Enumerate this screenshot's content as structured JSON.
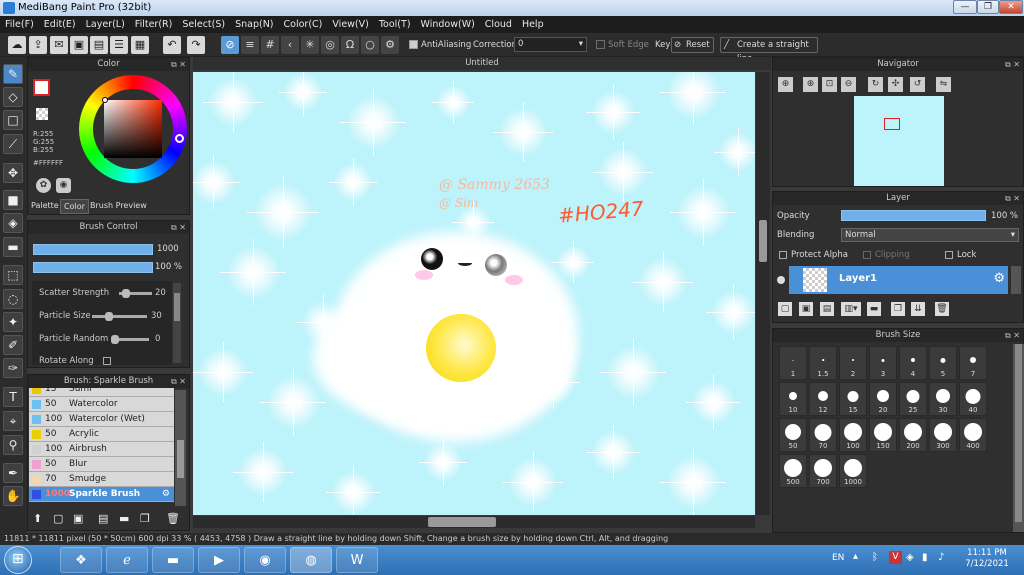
{
  "window": {
    "title": "MediBang Paint Pro (32bit)",
    "minimize": "—",
    "maximize": "❐",
    "close": "✕"
  },
  "menu": [
    "File(F)",
    "Edit(E)",
    "Layer(L)",
    "Filter(R)",
    "Select(S)",
    "Snap(N)",
    "Color(C)",
    "View(V)",
    "Tool(T)",
    "Window(W)",
    "Cloud",
    "Help"
  ],
  "toolbar": {
    "antialiasing": "AntiAliasing",
    "correction_label": "Correction",
    "correction_value": "0",
    "soft_edge": "Soft Edge",
    "key": "Key",
    "reset": "Reset",
    "straight_line": "Create a straight line"
  },
  "color_panel": {
    "title": "Color",
    "r": "R:255",
    "g": "G:255",
    "b": "B:255",
    "hex": "#FFFFFF",
    "tabs": [
      "Palette",
      "Color",
      "Brush Preview"
    ]
  },
  "brush_control": {
    "title": "Brush Control",
    "size": "1000",
    "opacity": "100 %",
    "params": [
      {
        "label": "Scatter Strength",
        "value": "20",
        "frac": 0.6
      },
      {
        "label": "Particle Size",
        "value": "30",
        "frac": 0.3
      },
      {
        "label": "Particle Random",
        "value": "0",
        "frac": 0.0
      },
      {
        "label": "Rotate Along",
        "value": ""
      }
    ]
  },
  "brush_list": {
    "title": "Brush: Sparkle Brush",
    "items": [
      {
        "size": "15",
        "name": "Sumi",
        "color": "#e8c800"
      },
      {
        "size": "50",
        "name": "Watercolor",
        "color": "#6ec0f0"
      },
      {
        "size": "100",
        "name": "Watercolor (Wet)",
        "color": "#6ec0f0"
      },
      {
        "size": "50",
        "name": "Acrylic",
        "color": "#e8d000"
      },
      {
        "size": "100",
        "name": "Airbrush",
        "color": "#d0d0d0"
      },
      {
        "size": "50",
        "name": "Blur",
        "color": "#f0a0d0"
      },
      {
        "size": "70",
        "name": "Smudge",
        "color": "#f0d8b0"
      },
      {
        "size": "1000",
        "name": "Sparkle Brush",
        "color": "#3050e0"
      }
    ]
  },
  "canvas": {
    "title": "Untitled",
    "text1": "@ Sammy 2653",
    "text2": "@ Sim",
    "text3": "#HO247"
  },
  "navigator": {
    "title": "Navigator"
  },
  "layer_panel": {
    "title": "Layer",
    "opacity_label": "Opacity",
    "opacity_value": "100 %",
    "opacity_frac": 1.0,
    "blending_label": "Blending",
    "blending_value": "Normal",
    "protect_alpha": "Protect Alpha",
    "clipping": "Clipping",
    "lock": "Lock",
    "layer_name": "Layer1"
  },
  "brush_size": {
    "title": "Brush Size",
    "sizes": [
      "1",
      "1.5",
      "2",
      "3",
      "4",
      "5",
      "7",
      "10",
      "12",
      "15",
      "20",
      "25",
      "30",
      "40",
      "50",
      "70",
      "100",
      "150",
      "200",
      "300",
      "400",
      "500",
      "700",
      "1000"
    ]
  },
  "status": "11811 * 11811 pixel   (50 * 50cm)   600 dpi   33 %   ( 4453, 4758 )   Draw a straight line by holding down Shift, Change a brush size by holding down Ctrl, Alt, and dragging",
  "taskbar": {
    "lang": "EN",
    "time": "11:11 PM",
    "date": "7/12/2021"
  },
  "colors": {
    "accent": "#4a90d9",
    "canvas": "#bdf3fb"
  }
}
